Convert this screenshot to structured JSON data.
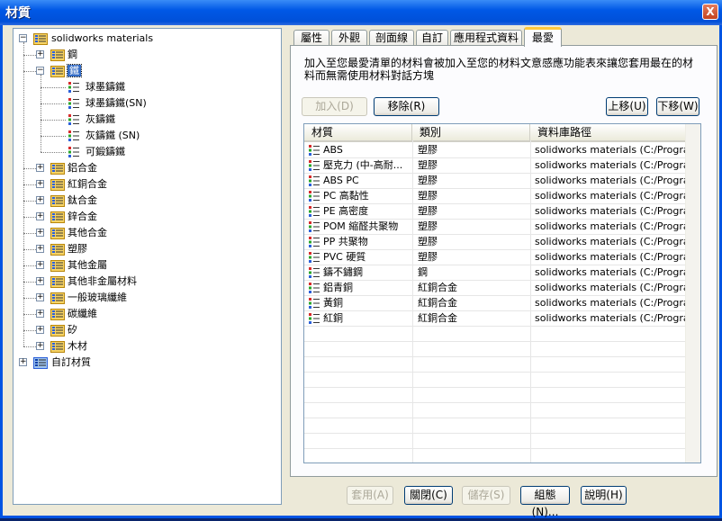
{
  "window": {
    "title": "材質",
    "close_glyph": "X"
  },
  "tree": {
    "root": {
      "label": "solidworks materials",
      "expander": "−"
    },
    "groups": [
      {
        "label": "鋼",
        "expander": "+"
      },
      {
        "label": "鐵",
        "expander": "−",
        "selected": true,
        "children": [
          {
            "label": "球墨鑄鐵"
          },
          {
            "label": "球墨鑄鐵(SN)"
          },
          {
            "label": "灰鑄鐵"
          },
          {
            "label": "灰鑄鐵 (SN)"
          },
          {
            "label": "可鍛鑄鐵"
          }
        ]
      },
      {
        "label": "鋁合金",
        "expander": "+"
      },
      {
        "label": "紅銅合金",
        "expander": "+"
      },
      {
        "label": "鈦合金",
        "expander": "+"
      },
      {
        "label": "鋅合金",
        "expander": "+"
      },
      {
        "label": "其他合金",
        "expander": "+"
      },
      {
        "label": "塑膠",
        "expander": "+"
      },
      {
        "label": "其他金屬",
        "expander": "+"
      },
      {
        "label": "其他非金屬材料",
        "expander": "+"
      },
      {
        "label": "一般玻璃纖維",
        "expander": "+"
      },
      {
        "label": "碳纖維",
        "expander": "+"
      },
      {
        "label": "矽",
        "expander": "+"
      },
      {
        "label": "木材",
        "expander": "+"
      }
    ],
    "custom_root": {
      "label": "自訂材質",
      "expander": "+"
    }
  },
  "tabs": [
    {
      "label": "屬性"
    },
    {
      "label": "外觀"
    },
    {
      "label": "剖面線"
    },
    {
      "label": "自訂"
    },
    {
      "label": "應用程式資料"
    },
    {
      "label": "最愛",
      "active": true
    }
  ],
  "favorites": {
    "description": "加入至您最愛清單的材料會被加入至您的材料文意感應功能表來讓您套用最在的材料而無需使用材料對話方塊",
    "buttons": {
      "add": "加入(D)",
      "remove": "移除(R)",
      "up": "上移(U)",
      "down": "下移(W)"
    },
    "columns": [
      "材質",
      "類別",
      "資料庫路徑"
    ],
    "rows": [
      {
        "material": "ABS",
        "category": "塑膠",
        "path": "solidworks materials (C:/Program Fi..."
      },
      {
        "material": "壓克力 (中-高耐...",
        "category": "塑膠",
        "path": "solidworks materials (C:/Program Fi..."
      },
      {
        "material": "ABS PC",
        "category": "塑膠",
        "path": "solidworks materials (C:/Program Fi..."
      },
      {
        "material": "PC 高黏性",
        "category": "塑膠",
        "path": "solidworks materials (C:/Program Fi..."
      },
      {
        "material": "PE 高密度",
        "category": "塑膠",
        "path": "solidworks materials (C:/Program Fi..."
      },
      {
        "material": "POM 縮醛共聚物",
        "category": "塑膠",
        "path": "solidworks materials (C:/Program Fi..."
      },
      {
        "material": "PP 共聚物",
        "category": "塑膠",
        "path": "solidworks materials (C:/Program Fi..."
      },
      {
        "material": "PVC 硬質",
        "category": "塑膠",
        "path": "solidworks materials (C:/Program Fi..."
      },
      {
        "material": "鑄不鏽鋼",
        "category": "鋼",
        "path": "solidworks materials (C:/Program Fi..."
      },
      {
        "material": "鋁青銅",
        "category": "紅銅合金",
        "path": "solidworks materials (C:/Program Fi..."
      },
      {
        "material": "黃銅",
        "category": "紅銅合金",
        "path": "solidworks materials (C:/Program Fi..."
      },
      {
        "material": "紅銅",
        "category": "紅銅合金",
        "path": "solidworks materials (C:/Program Fi..."
      }
    ]
  },
  "footer": {
    "apply": "套用(A)",
    "close": "關閉(C)",
    "save": "儲存(S)",
    "config": "組態(N)...",
    "help": "說明(H)"
  },
  "colors": {
    "titlebar": "#0058e6",
    "selection": "#316ac5",
    "active_tab_accent": "#ffc83c"
  }
}
